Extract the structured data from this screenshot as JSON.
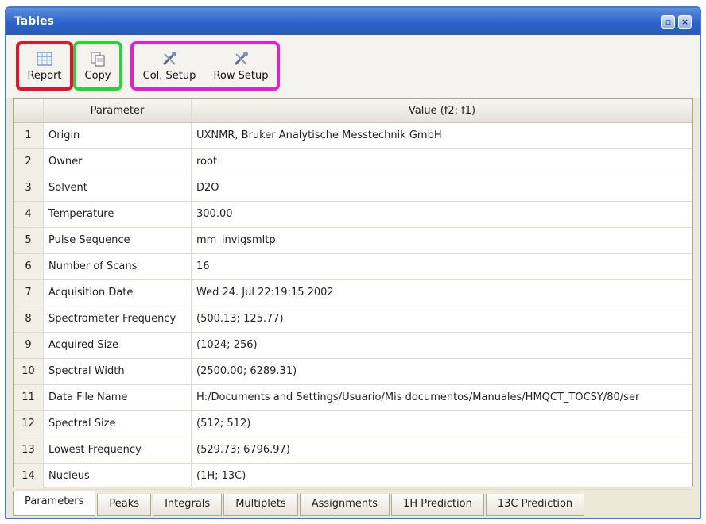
{
  "window": {
    "title": "Tables"
  },
  "toolbar": {
    "report_label": "Report",
    "copy_label": "Copy",
    "col_setup_label": "Col. Setup",
    "row_setup_label": "Row Setup"
  },
  "table": {
    "headers": {
      "num": "",
      "parameter": "Parameter",
      "value": "Value (f2; f1)"
    },
    "rows": [
      {
        "num": "1",
        "parameter": "Origin",
        "value": "UXNMR, Bruker Analytische Messtechnik GmbH"
      },
      {
        "num": "2",
        "parameter": "Owner",
        "value": "root"
      },
      {
        "num": "3",
        "parameter": "Solvent",
        "value": "D2O"
      },
      {
        "num": "4",
        "parameter": "Temperature",
        "value": "300.00"
      },
      {
        "num": "5",
        "parameter": "Pulse Sequence",
        "value": "mm_invigsmltp"
      },
      {
        "num": "6",
        "parameter": "Number of Scans",
        "value": "16"
      },
      {
        "num": "7",
        "parameter": "Acquisition Date",
        "value": "Wed 24. Jul 22:19:15 2002"
      },
      {
        "num": "8",
        "parameter": "Spectrometer Frequency",
        "value": "(500.13; 125.77)"
      },
      {
        "num": "9",
        "parameter": "Acquired Size",
        "value": "(1024; 256)"
      },
      {
        "num": "10",
        "parameter": "Spectral Width",
        "value": "(2500.00; 6289.31)"
      },
      {
        "num": "11",
        "parameter": "Data File Name",
        "value": "H:/Documents and Settings/Usuario/Mis documentos/Manuales/HMQCT_TOCSY/80/ser"
      },
      {
        "num": "12",
        "parameter": "Spectral Size",
        "value": "(512; 512)"
      },
      {
        "num": "13",
        "parameter": "Lowest Frequency",
        "value": "(529.73; 6796.97)"
      },
      {
        "num": "14",
        "parameter": "Nucleus",
        "value": "(1H; 13C)"
      }
    ]
  },
  "tabs": [
    {
      "label": "Parameters",
      "active": true
    },
    {
      "label": "Peaks",
      "active": false
    },
    {
      "label": "Integrals",
      "active": false
    },
    {
      "label": "Multiplets",
      "active": false
    },
    {
      "label": "Assignments",
      "active": false
    },
    {
      "label": "1H Prediction",
      "active": false
    },
    {
      "label": "13C Prediction",
      "active": false
    }
  ],
  "colors": {
    "highlight_red": "#e0142e",
    "highlight_green": "#27d336",
    "highlight_magenta": "#e21fd5",
    "titlebar": "#2c63c8"
  }
}
